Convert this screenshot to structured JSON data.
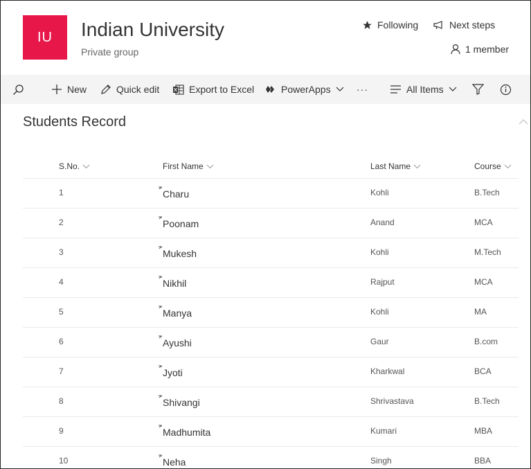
{
  "site": {
    "logo_text": "IU",
    "logo_color": "#e8174a",
    "title": "Indian University",
    "subtitle": "Private group"
  },
  "header_actions": {
    "following": "Following",
    "next_steps": "Next steps",
    "members": "1 member"
  },
  "commandbar": {
    "new": "New",
    "quick_edit": "Quick edit",
    "export": "Export to Excel",
    "powerapps": "PowerApps",
    "more": "···",
    "view": "All Items"
  },
  "list": {
    "title": "Students Record",
    "columns": [
      "S.No.",
      "First Name",
      "Last Name",
      "Course"
    ],
    "rows": [
      {
        "sno": "1",
        "first": "Charu",
        "last": "Kohli",
        "course": "B.Tech"
      },
      {
        "sno": "2",
        "first": "Poonam",
        "last": "Anand",
        "course": "MCA"
      },
      {
        "sno": "3",
        "first": "Mukesh",
        "last": "Kohli",
        "course": "M.Tech"
      },
      {
        "sno": "4",
        "first": "Nikhil",
        "last": "Rajput",
        "course": "MCA"
      },
      {
        "sno": "5",
        "first": "Manya",
        "last": "Kohli",
        "course": "MA"
      },
      {
        "sno": "6",
        "first": "Ayushi",
        "last": "Gaur",
        "course": "B.com"
      },
      {
        "sno": "7",
        "first": "Jyoti",
        "last": "Kharkwal",
        "course": "BCA"
      },
      {
        "sno": "8",
        "first": "Shivangi",
        "last": "Shrivastava",
        "course": "B.Tech"
      },
      {
        "sno": "9",
        "first": "Madhumita",
        "last": "Kumari",
        "course": "MBA"
      },
      {
        "sno": "10",
        "first": "Neha",
        "last": "Singh",
        "course": "BBA"
      }
    ]
  }
}
